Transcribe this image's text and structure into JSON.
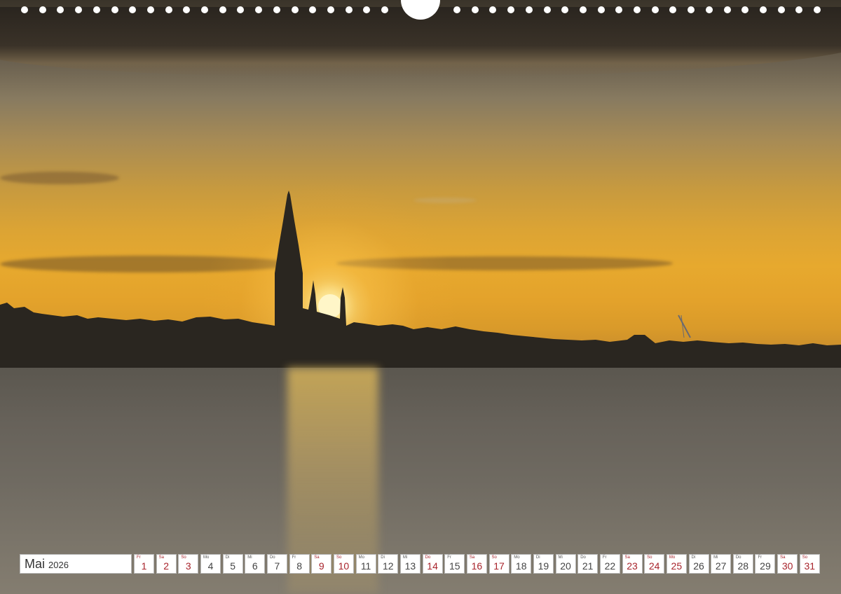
{
  "calendar": {
    "month": "Mai",
    "year": "2026",
    "days": [
      {
        "wd": "Fr",
        "num": "1",
        "red": true
      },
      {
        "wd": "Sa",
        "num": "2",
        "red": true
      },
      {
        "wd": "So",
        "num": "3",
        "red": true
      },
      {
        "wd": "Mo",
        "num": "4",
        "red": false
      },
      {
        "wd": "Di",
        "num": "5",
        "red": false
      },
      {
        "wd": "Mi",
        "num": "6",
        "red": false
      },
      {
        "wd": "Do",
        "num": "7",
        "red": false
      },
      {
        "wd": "Fr",
        "num": "8",
        "red": false
      },
      {
        "wd": "Sa",
        "num": "9",
        "red": true
      },
      {
        "wd": "So",
        "num": "10",
        "red": true
      },
      {
        "wd": "Mo",
        "num": "11",
        "red": false
      },
      {
        "wd": "Di",
        "num": "12",
        "red": false
      },
      {
        "wd": "Mi",
        "num": "13",
        "red": false
      },
      {
        "wd": "Do",
        "num": "14",
        "red": true
      },
      {
        "wd": "Fr",
        "num": "15",
        "red": false
      },
      {
        "wd": "Sa",
        "num": "16",
        "red": true
      },
      {
        "wd": "So",
        "num": "17",
        "red": true
      },
      {
        "wd": "Mo",
        "num": "18",
        "red": false
      },
      {
        "wd": "Di",
        "num": "19",
        "red": false
      },
      {
        "wd": "Mi",
        "num": "20",
        "red": false
      },
      {
        "wd": "Do",
        "num": "21",
        "red": false
      },
      {
        "wd": "Fr",
        "num": "22",
        "red": false
      },
      {
        "wd": "Sa",
        "num": "23",
        "red": true
      },
      {
        "wd": "So",
        "num": "24",
        "red": true
      },
      {
        "wd": "Mo",
        "num": "25",
        "red": true
      },
      {
        "wd": "Di",
        "num": "26",
        "red": false
      },
      {
        "wd": "Mi",
        "num": "27",
        "red": false
      },
      {
        "wd": "Do",
        "num": "28",
        "red": false
      },
      {
        "wd": "Fr",
        "num": "29",
        "red": false
      },
      {
        "wd": "Sa",
        "num": "30",
        "red": true
      },
      {
        "wd": "So",
        "num": "31",
        "red": true
      }
    ]
  },
  "colors": {
    "weekend_red": "#a8232b",
    "sky_gold": "#e7a92e",
    "water_grey": "#6f6a61"
  }
}
